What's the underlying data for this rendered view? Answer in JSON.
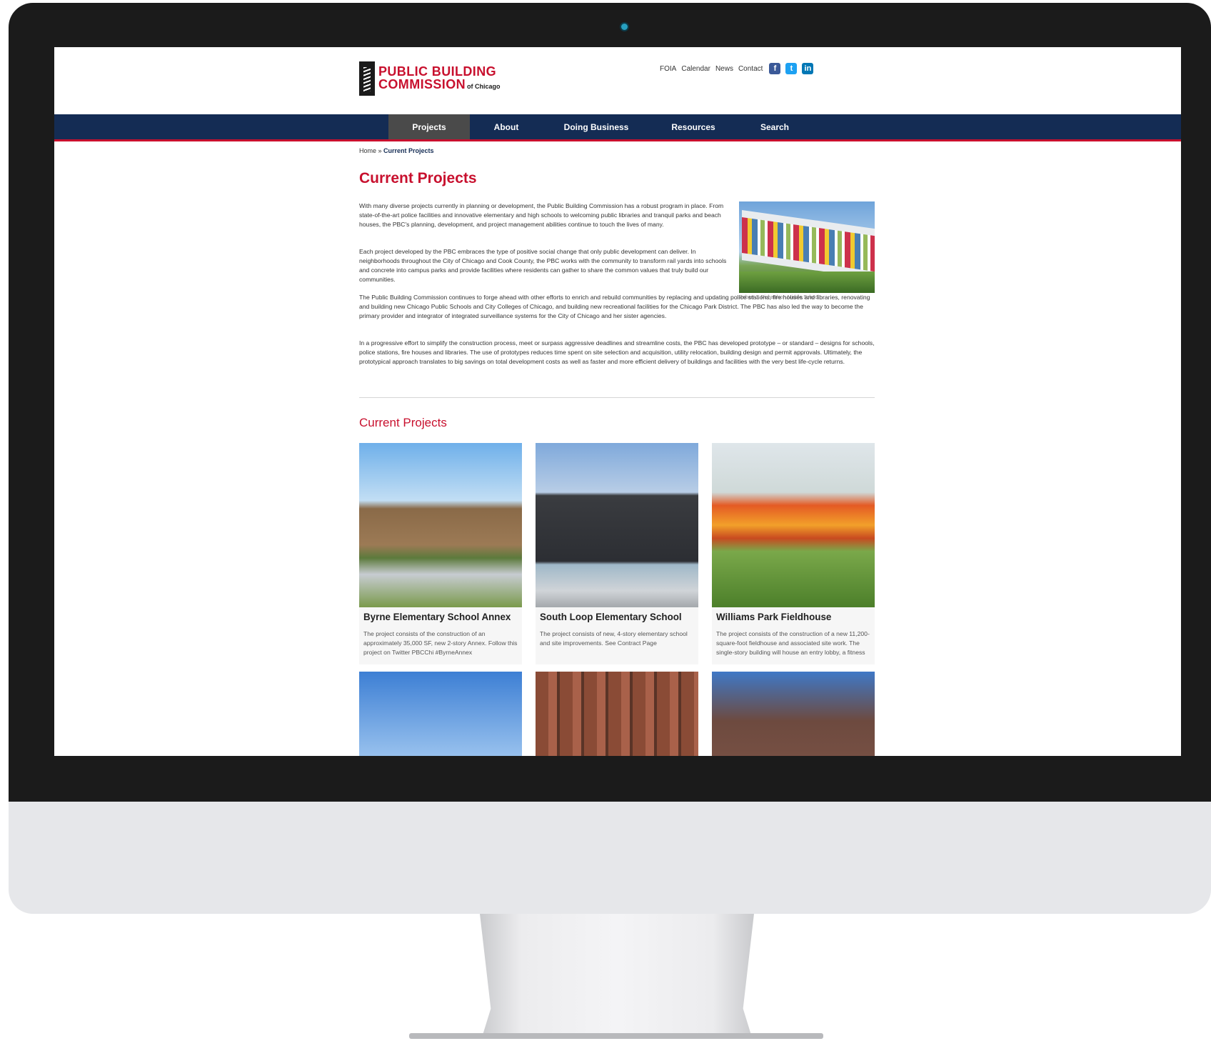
{
  "header": {
    "logo_line1": "PUBLIC BUILDING",
    "logo_line2": "COMMISSION",
    "logo_sub": "of Chicago",
    "top_links": [
      "FOIA",
      "Calendar",
      "News",
      "Contact"
    ],
    "social": [
      "f",
      "t",
      "in"
    ]
  },
  "nav": {
    "items": [
      "Projects",
      "About",
      "Doing Business",
      "Resources",
      "Search"
    ],
    "active": "Projects"
  },
  "breadcrumb": {
    "home": "Home",
    "sep": " » ",
    "current": "Current Projects"
  },
  "page": {
    "title": "Current Projects",
    "paragraphs": [
      "With many diverse projects currently in planning or development, the Public Building Commission has a robust program in place. From state-of-the-art police facilities and innovative elementary and high schools to welcoming public libraries and tranquil parks and beach houses, the PBC's planning, development, and project management abilities continue to touch the lives of many.",
      "Each project developed by the PBC embraces the type of positive social change that only public development can deliver. In neighborhoods throughout the City of Chicago and Cook County, the PBC works with the community to transform rail yards into schools and concrete into campus parks and provide facilities where residents can gather to share the common values that truly build our communities.",
      "The Public Building Commission continues to forge ahead with other efforts to enrich and rebuild communities by replacing and updating police stations, fire houses and libraries, renovating and building new Chicago Public Schools and City Colleges of Chicago, and building new recreational facilities for the Chicago Park District. The PBC has also led the way to become the primary provider and integrator of integrated surveillance systems for the City of Chicago and her sister agencies.",
      "In a progressive effort to simplify the construction process, meet or surpass aggressive deadlines and streamline costs, the PBC has developed prototype – or standard – designs for schools, police stations, fire houses and libraries. The use of prototypes reduces time spent on site selection and acquisition, utility relocation, building design and permit approvals. Ultimately, the prototypical approach translates to big savings on total development costs as well as faster and more efficient delivery of buildings and facilities with the very best life-cycle returns."
    ],
    "hero_caption": "Robert J. Richardson Middle School",
    "section_title": "Current Projects"
  },
  "projects": [
    {
      "title": "Byrne Elementary School Annex",
      "desc": "The project consists of the construction of an approximately 35,000 SF, new 2-story Annex. Follow this project on Twitter PBCChi #ByrneAnnex"
    },
    {
      "title": "South Loop Elementary School",
      "desc": "The project consists of new, 4-story elementary school and site improvements. See Contract Page"
    },
    {
      "title": "Williams Park Fieldhouse",
      "desc": "The project consists of the construction of a new 11,200-square-foot fieldhouse and associated site work. The single-story building will house an entry lobby, a fitness room, a multi-purpose room, offices and support spaces."
    }
  ]
}
